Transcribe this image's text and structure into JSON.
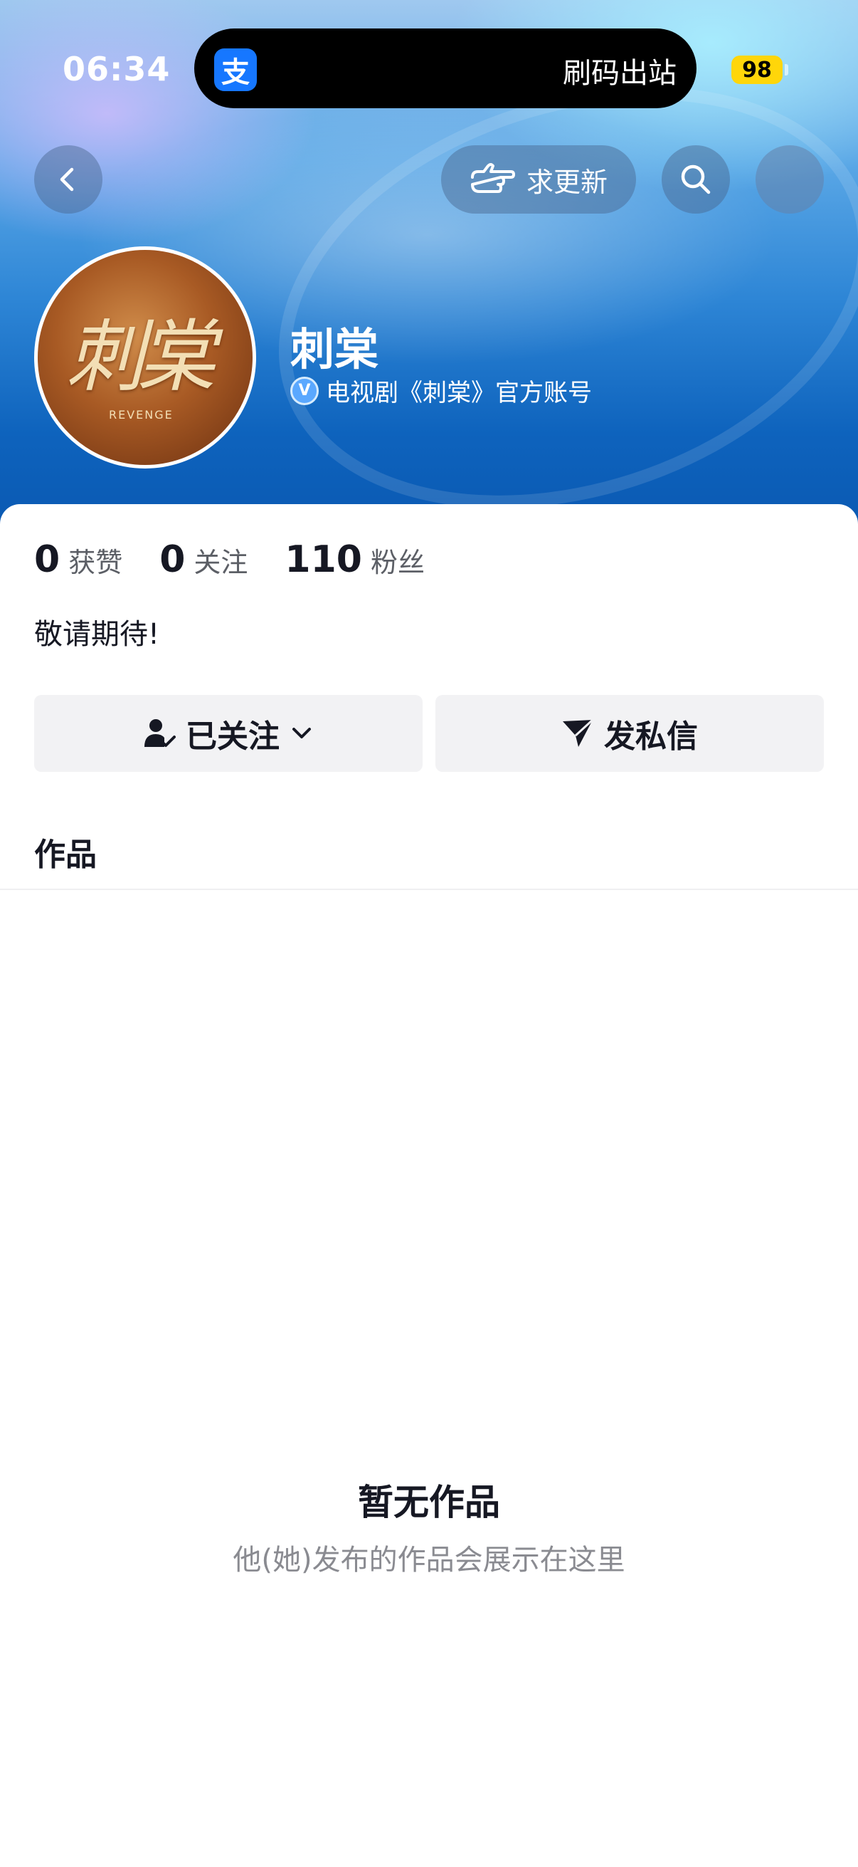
{
  "status_bar": {
    "time": "06:34",
    "island_app_icon": "支",
    "island_text": "刷码出站",
    "battery": "98"
  },
  "nav": {
    "update_label": "求更新",
    "icons": [
      "chevron-left-icon",
      "hand-pointing-icon",
      "search-icon"
    ]
  },
  "profile": {
    "avatar_text": "刺棠",
    "avatar_subtext": "REVENGE",
    "name": "刺棠",
    "verified_text": "电视剧《刺棠》官方账号"
  },
  "stats": [
    {
      "value": "0",
      "label": "获赞"
    },
    {
      "value": "0",
      "label": "关注"
    },
    {
      "value": "110",
      "label": "粉丝"
    }
  ],
  "bio": "敬请期待!",
  "actions": {
    "follow_label": "已关注",
    "message_label": "发私信"
  },
  "tabs": {
    "works_label": "作品"
  },
  "empty_state": {
    "title": "暂无作品",
    "subtitle": "他(她)发布的作品会展示在这里"
  },
  "colors": {
    "header_blue": "#0e63bd",
    "verify_blue": "#5aa8ff",
    "battery_yellow": "#ffd60a",
    "button_gray": "#f2f2f4"
  }
}
